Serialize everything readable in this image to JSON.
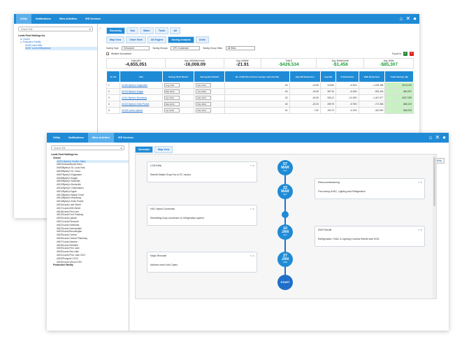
{
  "win1": {
    "nav": [
      "Utility",
      "Notifications",
      "Sites Activities",
      "IRE Services"
    ],
    "active_nav": "Utility",
    "search_placeholder": "Search Site",
    "tree": [
      "Lunds Food Holdings Inc.",
      "Closed",
      "Production Facility",
      "#1005 Lake Mills",
      "#1057 Lunds Willowbrook"
    ],
    "tabs": [
      "Electricity",
      "Gas",
      "Water",
      "Trash",
      "All"
    ],
    "subtabs": [
      "Map View",
      "Chart View",
      "All Engine",
      "Saving Analysis",
      "Units"
    ],
    "filters": {
      "saving_type_label": "Saving Type:",
      "saving_type_value": "Enhanced",
      "saving_groups_label": "Saving Groups:",
      "saving_groups_value": "VFD Condenser",
      "saving_group_sites_label": "Saving Group Sites:",
      "saving_group_sites_value": "All Sites",
      "weather_label": "Weather Normalized",
      "export_label": "Export to"
    },
    "summary": [
      {
        "label": "Total kWh",
        "value": "-4,655,051",
        "green": false
      },
      {
        "label": "Avg. kWh/site/month",
        "value": "-16,008.09",
        "green": false
      },
      {
        "label": "Avg. kW/site",
        "value": "-21.91",
        "green": false
      },
      {
        "label": "Total $",
        "value": "-$426,534",
        "green": true
      },
      {
        "label": "Avg. $/site/month",
        "value": "-$1,456",
        "green": true
      },
      {
        "label": "Avg. $/site",
        "value": "-$85,307",
        "green": true
      }
    ],
    "headers": [
      "Sr. No",
      "Site",
      "Saving Start Month",
      "Saving End Month",
      "No of Months (Check savings start month)",
      "Avg kW Reduction",
      "Avg kW",
      "% Reduction",
      "kWh Reduction",
      "Total Savings ($)"
    ],
    "rows": [
      [
        "1",
        "#1006 Byerly's Edgewater",
        "Aug-2011",
        "Mar-2012",
        "63",
        "-16.98",
        "316.80",
        "-5.32%",
        "-1,239,458",
        "-$113,043"
      ],
      [
        "2",
        "#1013 Byerly's Eagan",
        "Mar-2012",
        "Jun-2012",
        "63",
        "-18.49",
        "357.20",
        "-5.16%",
        "-932,424",
        "-$84,997"
      ],
      [
        "3",
        "#1101 Byerly's Woodbury",
        "Apr-2010",
        "Mar-2012",
        "63",
        "-45.35",
        "336.12",
        "-13.18%",
        "-1,447,577",
        "-$127,059"
      ],
      [
        "4",
        "#1030 Byerly's Eden Prairie",
        "Mar-2010",
        "Mar-2012",
        "63",
        "-20.33",
        "259.79",
        "-5.76%",
        "-717,836",
        "-$66,192"
      ],
      [
        "5",
        "#1045 Lunds Uptown",
        "Apr-2010",
        "Mar-2012",
        "61",
        "-7.82",
        "190.73",
        "-4.10%",
        "-442,590",
        "-$45,233"
      ]
    ]
  },
  "win2": {
    "nav": [
      "Utility",
      "Notifications",
      "Sites Activities",
      "IRE Services"
    ],
    "active_nav": "Sites Activities",
    "search_placeholder": "Search Site",
    "tree": [
      "Lunds Food Holdings Inc.",
      "Closed",
      "#1001-Byerly's Golden Valley",
      "#0003Lisbon/Burdin Eden",
      "#0005Byerly's St. Louis Park",
      "#0006Byerly's St. Cloud",
      "#0007Byerly's Edgewater",
      "#0008Byerly's Eagan",
      "#0009Byerly's Roseville",
      "#0010Byerly's Burnsville",
      "#0011Byerly's Chanhassen",
      "#0012Byerly's Apple",
      "#0013Byerly's Maple Grove",
      "#0014Byerly's Woodbury",
      "#0015Byerly's Eden Prairie",
      "#0016Lunds Lake Street",
      "#0017Lunds 50th Street",
      "#0018Lunds Penn Ave",
      "#0019Lunds Ford Parkway",
      "#0020Lunds Uptown",
      "#0021Lunds Plymouth",
      "#0022Lunds Northeast",
      "#0023Lunds Normandale",
      "#0024Lunds Bloomington",
      "#0025Lunds Central",
      "#0026Lunds Central Pharmacy",
      "#0027Lunds Navarre",
      "#0028Lunds Richfield",
      "#0029Lunds Pine Lake",
      "#0030Lunds Sea Lake",
      "#0031Lunds Prior Lake CDO",
      "#0032Prospect CO10",
      "#0033Lunds Vernon HSV",
      "Production Facility"
    ],
    "tabs": [
      "Schedule",
      "Map View"
    ],
    "site_title": "Site : #1001-Byerly's Golden Valley",
    "year_label": "Year:",
    "year_value": "All Year",
    "activity_label": "Activity Type:",
    "activity_value": "All Activity Type",
    "add_activity": "Add Activity",
    "nodes": [
      {
        "day": "07",
        "month": "MAR",
        "year": "2017"
      },
      {
        "day": "22",
        "month": "MAR",
        "year": "2017"
      },
      {
        "day": "09",
        "month": "MAR",
        "year": "2017"
      },
      {
        "day": "10",
        "month": "JAN",
        "year": "2017"
      },
      {
        "day": "27",
        "month": "JAN",
        "year": "2008"
      }
    ],
    "start_label": "START",
    "cards": [
      {
        "title": "LCM-Refly",
        "desc": "Retrofit Walkin Evap Fan to EC motors"
      },
      {
        "title": "Retrocommissioning",
        "desc": "Fine-tuning HVAC, Lighting and Refrigeration"
      },
      {
        "title": "HAC Hybrid Condenser",
        "desc": "Retrofitting evap condenser on refrigeration system."
      },
      {
        "title": "EMS Retrofit",
        "desc": "Refrigeration, HVAC & Lighting Controls Retrofit with ECM"
      },
      {
        "title": "Major-Remodel",
        "desc": "Addnew reach-Info Cases"
      }
    ]
  }
}
